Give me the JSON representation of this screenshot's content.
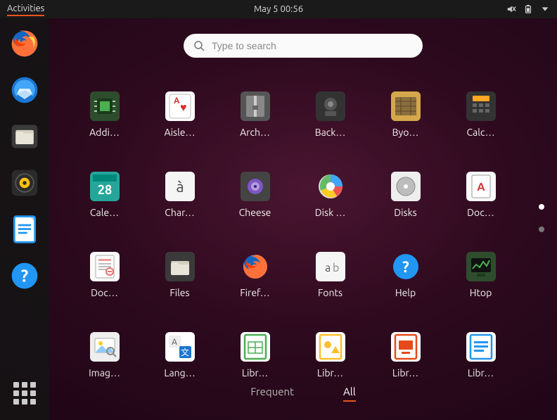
{
  "topbar": {
    "activities": "Activities",
    "datetime": "May 5  00:56"
  },
  "search": {
    "placeholder": "Type to search"
  },
  "dock": {
    "items": [
      {
        "name": "firefox"
      },
      {
        "name": "thunderbird"
      },
      {
        "name": "files"
      },
      {
        "name": "rhythmbox"
      },
      {
        "name": "libreoffice-writer"
      },
      {
        "name": "help"
      }
    ]
  },
  "apps": [
    {
      "label": "Addi…",
      "icon": "chip"
    },
    {
      "label": "Aisle…",
      "icon": "card"
    },
    {
      "label": "Arch…",
      "icon": "archive"
    },
    {
      "label": "Back…",
      "icon": "safe"
    },
    {
      "label": "Byo…",
      "icon": "byobu"
    },
    {
      "label": "Calc…",
      "icon": "calc"
    },
    {
      "label": "Cale…",
      "icon": "calendar",
      "badge": "28"
    },
    {
      "label": "Char…",
      "icon": "char"
    },
    {
      "label": "Cheese",
      "icon": "cheese"
    },
    {
      "label": "Disk …",
      "icon": "disk-usage"
    },
    {
      "label": "Disks",
      "icon": "disks"
    },
    {
      "label": "Doc…",
      "icon": "doc-a"
    },
    {
      "label": "Doc…",
      "icon": "doc-viewer"
    },
    {
      "label": "Files",
      "icon": "folder"
    },
    {
      "label": "Firef…",
      "icon": "firefox"
    },
    {
      "label": "Fonts",
      "icon": "fonts"
    },
    {
      "label": "Help",
      "icon": "help"
    },
    {
      "label": "Htop",
      "icon": "htop"
    },
    {
      "label": "Imag…",
      "icon": "image"
    },
    {
      "label": "Lang…",
      "icon": "lang"
    },
    {
      "label": "Libr…",
      "icon": "lo-calc"
    },
    {
      "label": "Libr…",
      "icon": "lo-draw"
    },
    {
      "label": "Libr…",
      "icon": "lo-impress"
    },
    {
      "label": "Libr…",
      "icon": "lo-writer"
    }
  ],
  "tabs": {
    "frequent": "Frequent",
    "all": "All"
  },
  "pager": {
    "pages": 2,
    "active": 0
  }
}
